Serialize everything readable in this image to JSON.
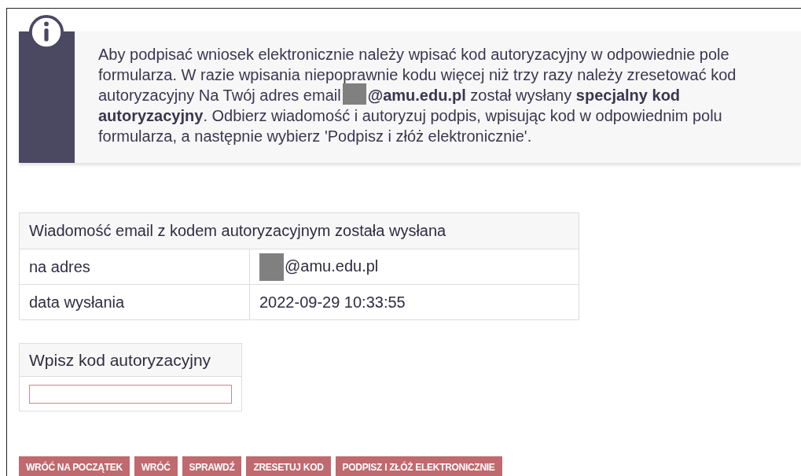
{
  "notice": {
    "text_before": "Aby podpisać wniosek elektronicznie należy wpisać kod autoryzacyjny w odpowiednie pole formularza. W razie wpisania niepoprawnie kodu więcej niż trzy razy należy zresetować kod autoryzacyjny Na Twój adres email",
    "redacted": true,
    "text_after": "**@amu.edu.pl** został wysłany **specjalny kod autoryzacyjny**. Odbierz wiadomość i autoryzuj podpis, wpisując kod w odpowiednim polu formularza, a następnie wybierz 'Podpisz i złóż elektronicznie'."
  },
  "sent_table": {
    "title": "Wiadomość email z kodem autoryzacyjnym została wysłana",
    "rows": [
      {
        "label": "na adres",
        "value": "@amu.edu.pl",
        "redacted": true
      },
      {
        "label": "data wysłania",
        "value": "2022-09-29 10:33:55",
        "redacted": false
      }
    ]
  },
  "code_form": {
    "title": "Wpisz kod autoryzacyjny"
  },
  "buttons": [
    "WRÓĆ NA POCZĄTEK",
    "WRÓĆ",
    "SPRAWDŹ",
    "ZRESETUJ KOD",
    "PODPISZ I ZŁÓŻ ELEKTRONICZNIE"
  ]
}
